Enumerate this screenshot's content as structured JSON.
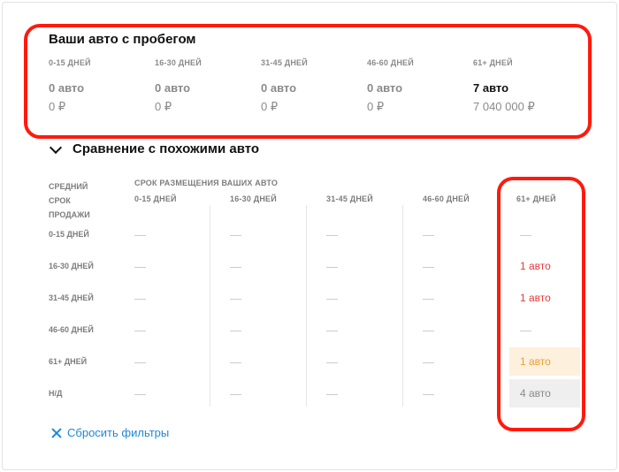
{
  "mileage": {
    "title": "Ваши авто с пробегом",
    "columns": [
      {
        "label": "0-15 ДНЕЙ",
        "count": "0 авто",
        "sum": "0 ₽"
      },
      {
        "label": "16-30 ДНЕЙ",
        "count": "0 авто",
        "sum": "0 ₽"
      },
      {
        "label": "31-45 ДНЕЙ",
        "count": "0 авто",
        "sum": "0 ₽"
      },
      {
        "label": "46-60 ДНЕЙ",
        "count": "0 авто",
        "sum": "0 ₽"
      },
      {
        "label": "61+ ДНЕЙ",
        "count": "7 авто",
        "sum": "7 040 000 ₽"
      }
    ]
  },
  "comparison": {
    "title": "Сравнение с похожими авто",
    "row_header_lines": [
      "СРЕДНИЙ",
      "СРОК",
      "ПРОДАЖИ"
    ],
    "group_header": "СРОК РАЗМЕЩЕНИЯ ВАШИХ АВТО",
    "col_headers": [
      "0-15 ДНЕЙ",
      "16-30 ДНЕЙ",
      "31-45 ДНЕЙ",
      "46-60 ДНЕЙ",
      "61+ ДНЕЙ"
    ],
    "rows": [
      {
        "label": "0-15 ДНЕЙ",
        "cells": [
          "—",
          "—",
          "—",
          "—",
          "—"
        ]
      },
      {
        "label": "16-30 ДНЕЙ",
        "cells": [
          "—",
          "—",
          "—",
          "—",
          "1 авто"
        ]
      },
      {
        "label": "31-45 ДНЕЙ",
        "cells": [
          "—",
          "—",
          "—",
          "—",
          "1 авто"
        ]
      },
      {
        "label": "46-60 ДНЕЙ",
        "cells": [
          "—",
          "—",
          "—",
          "—",
          "—"
        ]
      },
      {
        "label": "61+ ДНЕЙ",
        "cells": [
          "—",
          "—",
          "—",
          "—",
          "1 авто"
        ]
      },
      {
        "label": "Н/Д",
        "cells": [
          "—",
          "—",
          "—",
          "—",
          "4 авто"
        ]
      }
    ]
  },
  "reset_label": "Сбросить фильтры",
  "colors": {
    "annotation": "#ff1a0d",
    "highlight_red": "#e53a3a",
    "highlight_orange": "#e8a03a",
    "link": "#1e88d6"
  }
}
